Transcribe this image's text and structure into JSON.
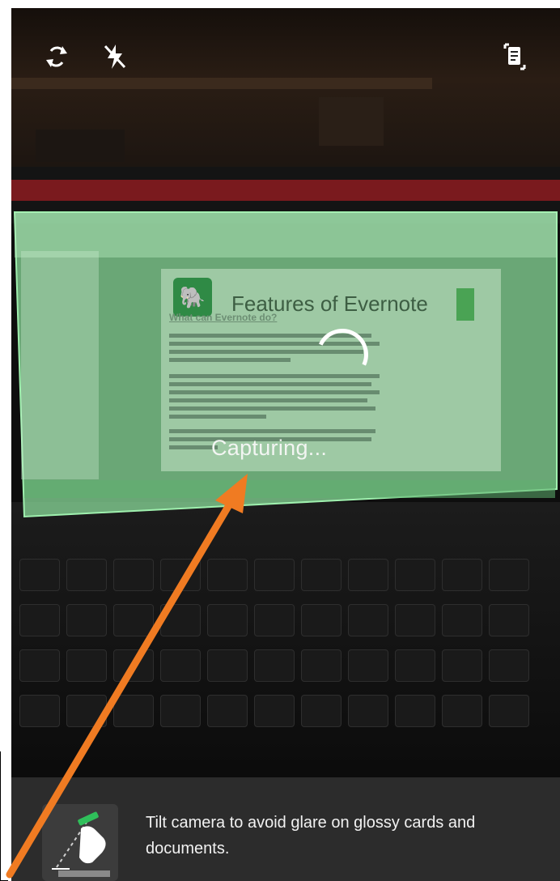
{
  "toolbar": {
    "switch_camera_icon": "camera-switch-icon",
    "flash_icon": "flash-off-icon",
    "document_mode_icon": "document-mode-icon"
  },
  "slide": {
    "title": "Features of Evernote",
    "subtitle": "What can Evernote do?"
  },
  "status": {
    "capturing_label": "Capturing..."
  },
  "tip": {
    "text": "Tilt camera to avoid glare on glossy cards and documents.",
    "icon": "tilt-camera-icon"
  },
  "colors": {
    "overlay_green": "#8fe3a0",
    "arrow_orange": "#f07b22",
    "tip_bar": "#2c2c2c"
  }
}
